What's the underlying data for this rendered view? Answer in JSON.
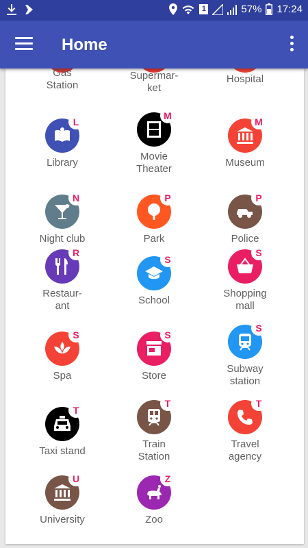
{
  "status": {
    "battery": "57%",
    "time": "17:24",
    "sim_number": "1"
  },
  "appbar": {
    "title": "Home"
  },
  "partial_row": [
    {
      "label": "Gas\nStation",
      "color": "#e53935"
    },
    {
      "label": "Grocery or\nSupermar-\nket",
      "color": "#e53935"
    },
    {
      "label": "Hospital",
      "color": "#f44336"
    }
  ],
  "items": [
    {
      "label": "Library",
      "badge": "L",
      "color": "#3f51b5",
      "icon": "book-icon"
    },
    {
      "label": "Movie\nTheater",
      "badge": "M",
      "color": "#000000",
      "icon": "film-icon"
    },
    {
      "label": "Museum",
      "badge": "M",
      "color": "#f44336",
      "icon": "museum-icon"
    },
    {
      "label": "Night club",
      "badge": "N",
      "color": "#607d8b",
      "icon": "cocktail-icon"
    },
    {
      "label": "Park",
      "badge": "P",
      "color": "#ff5722",
      "icon": "tree-icon"
    },
    {
      "label": "Police",
      "badge": "P",
      "color": "#795548",
      "icon": "police-car-icon"
    },
    {
      "label": "Restaur-\nant",
      "badge": "R",
      "color": "#673ab7",
      "icon": "fork-knife-icon"
    },
    {
      "label": "School",
      "badge": "S",
      "color": "#2196f3",
      "icon": "graduation-cap-icon"
    },
    {
      "label": "Shopping\nmall",
      "badge": "S",
      "color": "#e91e63",
      "icon": "basket-icon"
    },
    {
      "label": "Spa",
      "badge": "S",
      "color": "#f44336",
      "icon": "lotus-icon"
    },
    {
      "label": "Store",
      "badge": "S",
      "color": "#e91e63",
      "icon": "storefront-icon"
    },
    {
      "label": "Subway\nstation",
      "badge": "S",
      "color": "#2196f3",
      "icon": "subway-icon"
    },
    {
      "label": "Taxi stand",
      "badge": "T",
      "color": "#000000",
      "icon": "taxi-icon"
    },
    {
      "label": "Train\nStation",
      "badge": "T",
      "color": "#795548",
      "icon": "train-icon"
    },
    {
      "label": "Travel\nagency",
      "badge": "T",
      "color": "#f44336",
      "icon": "phone-icon"
    },
    {
      "label": "University",
      "badge": "U",
      "color": "#795548",
      "icon": "university-icon"
    },
    {
      "label": "Zoo",
      "badge": "Z",
      "color": "#9c27b0",
      "icon": "animal-icon"
    }
  ]
}
